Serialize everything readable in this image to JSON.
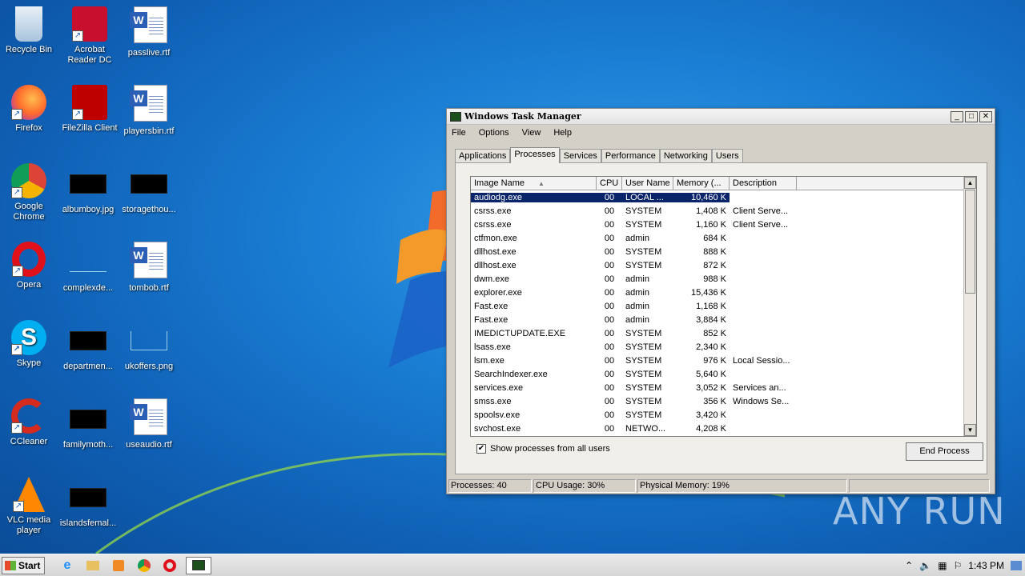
{
  "desktop": {
    "icons": [
      {
        "label": "Recycle Bin"
      },
      {
        "label": "Acrobat Reader DC"
      },
      {
        "label": "passlive.rtf"
      },
      {
        "label": "Firefox"
      },
      {
        "label": "FileZilla Client"
      },
      {
        "label": "playersbin.rtf"
      },
      {
        "label": "Google Chrome"
      },
      {
        "label": "albumboy.jpg"
      },
      {
        "label": "storagethou..."
      },
      {
        "label": "Opera"
      },
      {
        "label": "complexde..."
      },
      {
        "label": "tombob.rtf"
      },
      {
        "label": "Skype"
      },
      {
        "label": "departmen..."
      },
      {
        "label": "ukoffers.png"
      },
      {
        "label": "CCleaner"
      },
      {
        "label": "familymoth..."
      },
      {
        "label": "useaudio.rtf"
      },
      {
        "label": "VLC media player"
      },
      {
        "label": "islandsfemal..."
      }
    ]
  },
  "task_manager": {
    "title": "Windows Task Manager",
    "menu": [
      "File",
      "Options",
      "View",
      "Help"
    ],
    "tabs": [
      "Applications",
      "Processes",
      "Services",
      "Performance",
      "Networking",
      "Users"
    ],
    "active_tab": "Processes",
    "columns": [
      "Image Name",
      "CPU",
      "User Name",
      "Memory (...",
      "Description"
    ],
    "rows": [
      {
        "name": "audiodg.exe",
        "cpu": "00",
        "user": "LOCAL ...",
        "mem": "10,460 K",
        "desc": ""
      },
      {
        "name": "csrss.exe",
        "cpu": "00",
        "user": "SYSTEM",
        "mem": "1,408 K",
        "desc": "Client Serve..."
      },
      {
        "name": "csrss.exe",
        "cpu": "00",
        "user": "SYSTEM",
        "mem": "1,160 K",
        "desc": "Client Serve..."
      },
      {
        "name": "ctfmon.exe",
        "cpu": "00",
        "user": "admin",
        "mem": "684 K",
        "desc": ""
      },
      {
        "name": "dllhost.exe",
        "cpu": "00",
        "user": "SYSTEM",
        "mem": "888 K",
        "desc": ""
      },
      {
        "name": "dllhost.exe",
        "cpu": "00",
        "user": "SYSTEM",
        "mem": "872 K",
        "desc": ""
      },
      {
        "name": "dwm.exe",
        "cpu": "00",
        "user": "admin",
        "mem": "988 K",
        "desc": ""
      },
      {
        "name": "explorer.exe",
        "cpu": "00",
        "user": "admin",
        "mem": "15,436 K",
        "desc": ""
      },
      {
        "name": "Fast.exe",
        "cpu": "00",
        "user": "admin",
        "mem": "1,168 K",
        "desc": ""
      },
      {
        "name": "Fast.exe",
        "cpu": "00",
        "user": "admin",
        "mem": "3,884 K",
        "desc": ""
      },
      {
        "name": "IMEDICTUPDATE.EXE",
        "cpu": "00",
        "user": "SYSTEM",
        "mem": "852 K",
        "desc": ""
      },
      {
        "name": "lsass.exe",
        "cpu": "00",
        "user": "SYSTEM",
        "mem": "2,340 K",
        "desc": ""
      },
      {
        "name": "lsm.exe",
        "cpu": "00",
        "user": "SYSTEM",
        "mem": "976 K",
        "desc": "Local Sessio..."
      },
      {
        "name": "SearchIndexer.exe",
        "cpu": "00",
        "user": "SYSTEM",
        "mem": "5,640 K",
        "desc": ""
      },
      {
        "name": "services.exe",
        "cpu": "00",
        "user": "SYSTEM",
        "mem": "3,052 K",
        "desc": "Services an..."
      },
      {
        "name": "smss.exe",
        "cpu": "00",
        "user": "SYSTEM",
        "mem": "356 K",
        "desc": "Windows Se..."
      },
      {
        "name": "spoolsv.exe",
        "cpu": "00",
        "user": "SYSTEM",
        "mem": "3,420 K",
        "desc": ""
      },
      {
        "name": "svchost.exe",
        "cpu": "00",
        "user": "NETWO...",
        "mem": "4,208 K",
        "desc": ""
      }
    ],
    "show_all_label": "Show processes from all users",
    "show_all_checked": true,
    "end_process_label": "End Process",
    "status": {
      "processes": "Processes: 40",
      "cpu": "CPU Usage: 30%",
      "memory": "Physical Memory: 19%"
    }
  },
  "taskbar": {
    "start_label": "Start",
    "clock": "1:43 PM"
  },
  "watermark": "ANY RUN"
}
